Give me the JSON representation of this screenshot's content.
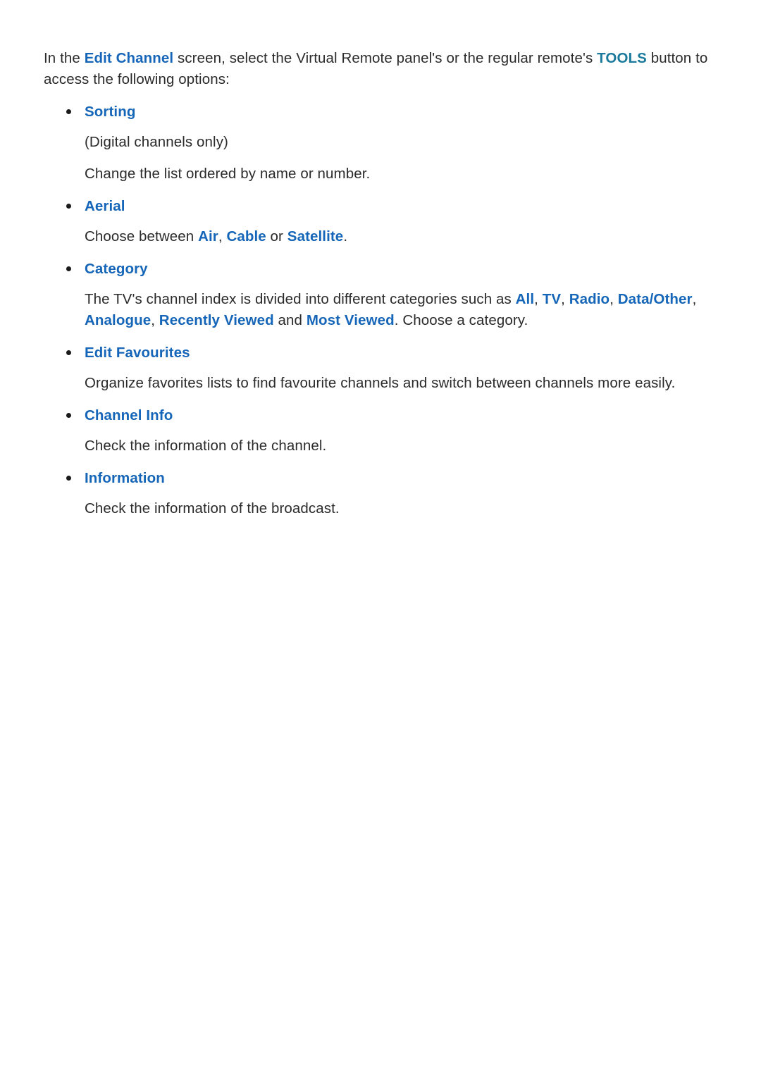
{
  "document": {
    "intro": {
      "prefix": "In the ",
      "term_edit_channel": "Edit Channel",
      "middle": " screen, select the Virtual Remote panel's or the regular remote's ",
      "term_tools": "TOOLS",
      "suffix": " button to access the following options:"
    },
    "sections": [
      {
        "title": "Sorting",
        "lines": [
          {
            "text": "(Digital channels only)"
          },
          {
            "text": "Change the list ordered by name or number."
          }
        ]
      },
      {
        "title": "Aerial",
        "aerial_line": {
          "prefix": "Choose between ",
          "term_air": "Air",
          "sep1": ", ",
          "term_cable": "Cable",
          "sep2": " or ",
          "term_satellite": "Satellite",
          "suffix": "."
        }
      },
      {
        "title": "Category",
        "category_line": {
          "prefix": "The TV's channel index is divided into different categories such as ",
          "term_all": "All",
          "sep1": ", ",
          "term_tv": "TV",
          "sep2": ", ",
          "term_radio": "Radio",
          "sep3": ", ",
          "term_data_other": "Data/Other",
          "sep4": ", ",
          "term_analogue": "Analogue",
          "sep5": ", ",
          "term_recently_viewed": "Recently Viewed",
          "sep6": " and ",
          "term_most_viewed": "Most Viewed",
          "suffix": ". Choose a category."
        }
      },
      {
        "title": "Edit Favourites",
        "lines": [
          {
            "text": "Organize favorites lists to find favourite channels and switch between channels more easily."
          }
        ]
      },
      {
        "title": "Channel Info",
        "lines": [
          {
            "text": "Check the information of the channel."
          }
        ]
      },
      {
        "title": "Information",
        "lines": [
          {
            "text": "Check the information of the broadcast."
          }
        ]
      }
    ],
    "colors": {
      "accent_blue": "#1565b8",
      "accent_teal": "#1b7a9c",
      "body_text": "#2b2b2b",
      "background": "#ffffff"
    }
  }
}
